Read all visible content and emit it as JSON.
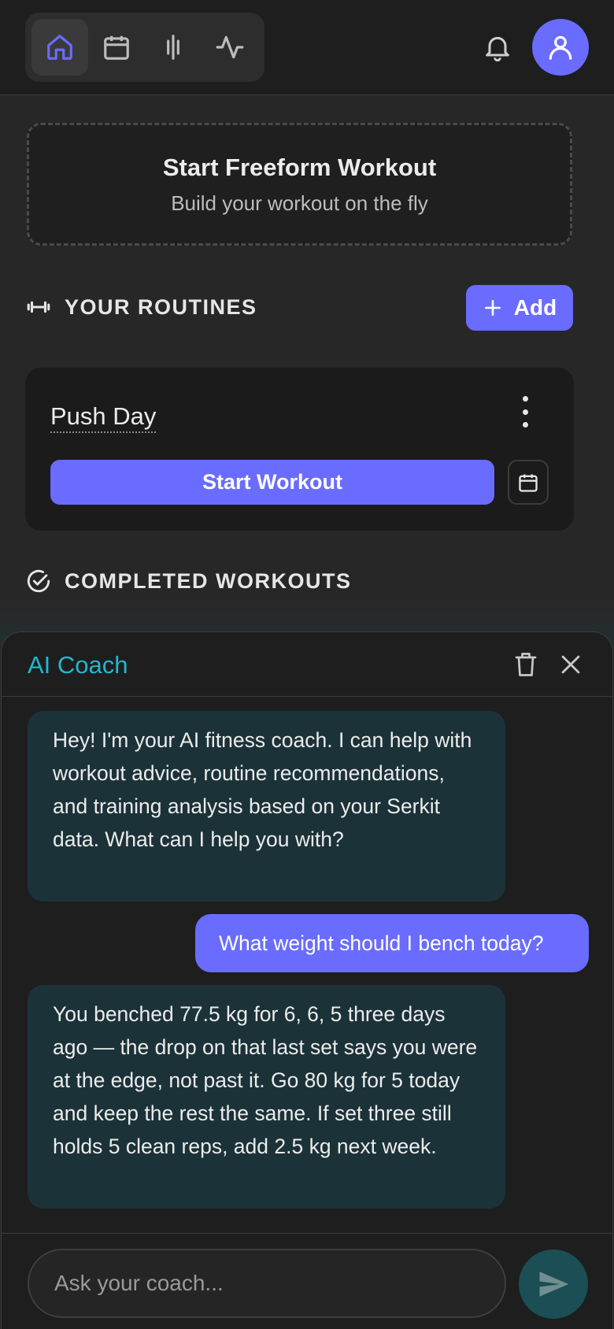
{
  "nav": {
    "items": [
      {
        "icon": "home-icon",
        "active": true
      },
      {
        "icon": "calendar-icon",
        "active": false
      },
      {
        "icon": "stats-bars-icon",
        "active": false
      },
      {
        "icon": "activity-icon",
        "active": false
      }
    ]
  },
  "freeform": {
    "title": "Start Freeform Workout",
    "subtitle": "Build your workout on the fly"
  },
  "routines": {
    "header": "YOUR ROUTINES",
    "add_label": "Add",
    "items": [
      {
        "name": "Push Day",
        "start_label": "Start Workout"
      }
    ]
  },
  "completed": {
    "header": "COMPLETED WORKOUTS"
  },
  "coach": {
    "title": "AI Coach",
    "messages": [
      {
        "role": "assistant",
        "text": "Hey! I'm your AI fitness coach. I can help with workout advice, routine recommendations, and training analysis based on your Serkit data. What can I help you with?"
      },
      {
        "role": "user",
        "text": "What weight should I bench today?"
      },
      {
        "role": "assistant",
        "text": "You benched 77.5 kg for 6, 6, 5 three days ago — the drop on that last set says you were at the edge, not past it. Go 80 kg for 5 today and keep the rest the same. If set three still holds 5 clean reps, add 2.5 kg next week."
      }
    ],
    "input_placeholder": "Ask your coach..."
  },
  "colors": {
    "accent": "#6a6cff",
    "coach_title": "#1fb8cf",
    "bot_bubble": "#1b3238",
    "send_button": "#1b4e55"
  }
}
